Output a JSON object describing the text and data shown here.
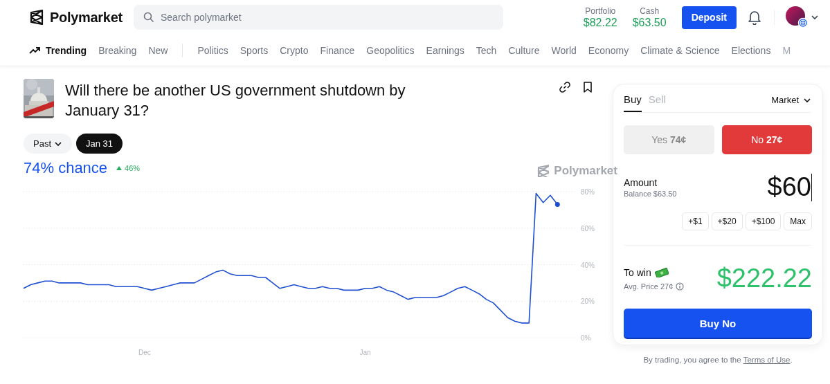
{
  "header": {
    "brand": "Polymarket",
    "search": {
      "placeholder": "Search polymarket"
    },
    "stats": [
      {
        "label": "Portfolio",
        "value": "$82.22"
      },
      {
        "label": "Cash",
        "value": "$63.50"
      }
    ],
    "deposit_button": "Deposit"
  },
  "nav": {
    "items": [
      {
        "label": "Trending",
        "kind": "feed",
        "selected": true,
        "faded": false
      },
      {
        "label": "Breaking",
        "kind": "feed",
        "selected": false,
        "faded": false
      },
      {
        "label": "New",
        "kind": "feed",
        "selected": false,
        "faded": false
      },
      {
        "label": "Politics",
        "kind": "category",
        "selected": false,
        "faded": false
      },
      {
        "label": "Sports",
        "kind": "category",
        "selected": false,
        "faded": false
      },
      {
        "label": "Crypto",
        "kind": "category",
        "selected": false,
        "faded": false
      },
      {
        "label": "Finance",
        "kind": "category",
        "selected": false,
        "faded": false
      },
      {
        "label": "Geopolitics",
        "kind": "category",
        "selected": false,
        "faded": false
      },
      {
        "label": "Earnings",
        "kind": "category",
        "selected": false,
        "faded": false
      },
      {
        "label": "Tech",
        "kind": "category",
        "selected": false,
        "faded": false
      },
      {
        "label": "Culture",
        "kind": "category",
        "selected": false,
        "faded": false
      },
      {
        "label": "World",
        "kind": "category",
        "selected": false,
        "faded": false
      },
      {
        "label": "Economy",
        "kind": "category",
        "selected": false,
        "faded": false
      },
      {
        "label": "Climate & Science",
        "kind": "category",
        "selected": false,
        "faded": false
      },
      {
        "label": "Elections",
        "kind": "category",
        "selected": false,
        "faded": false
      },
      {
        "label": "M",
        "kind": "category",
        "selected": false,
        "faded": true
      }
    ]
  },
  "market": {
    "title": "Will there be another US government shutdown by January 31?",
    "filters": [
      {
        "label": "Past",
        "kind": "dropdown",
        "selected": false
      },
      {
        "label": "Jan 31",
        "kind": "pill",
        "selected": true
      }
    ],
    "chance": "74% chance",
    "change": "46%",
    "watermark": "Polymarket",
    "chart_data": {
      "type": "line",
      "categories": [
        null,
        null,
        null,
        null,
        null,
        null,
        null,
        null,
        null,
        null,
        null,
        null,
        null,
        null,
        null,
        null,
        null,
        "Dec",
        null,
        null,
        null,
        null,
        null,
        null,
        null,
        null,
        null,
        null,
        null,
        null,
        null,
        null,
        null,
        null,
        null,
        null,
        null,
        null,
        null,
        null,
        null,
        null,
        null,
        null,
        null,
        null,
        null,
        null,
        "Jan",
        null,
        null,
        null,
        null,
        null,
        null,
        null,
        null,
        null,
        null,
        null,
        null,
        null,
        null,
        null,
        null,
        null,
        null,
        null,
        null,
        null,
        null,
        null,
        null,
        null,
        null,
        null
      ],
      "series": [
        {
          "color": "#1f4fd1",
          "values": [
            27,
            29,
            30,
            31,
            31,
            30,
            30,
            30,
            30,
            29,
            29,
            29,
            29,
            28,
            28,
            28,
            28,
            27,
            26,
            27,
            28,
            29,
            30,
            30,
            30,
            32,
            34,
            36,
            37,
            35,
            34,
            34,
            34,
            33,
            33,
            30,
            27,
            28,
            29,
            28,
            27,
            27,
            28,
            27,
            27,
            26,
            26,
            26,
            27,
            27,
            28,
            26,
            25,
            23,
            21,
            22,
            22,
            22,
            22,
            23,
            25,
            27,
            28,
            26,
            24,
            21,
            19,
            15,
            11,
            9,
            8,
            8,
            79,
            74,
            78,
            73
          ]
        }
      ],
      "ylim": [
        0,
        80
      ],
      "grid": true,
      "yticks": [
        {
          "value": 0,
          "label": "0%"
        },
        {
          "value": 20,
          "label": "20%"
        },
        {
          "value": 40,
          "label": "40%"
        },
        {
          "value": 60,
          "label": "60%"
        },
        {
          "value": 80,
          "label": "80%"
        }
      ]
    }
  },
  "trade": {
    "tabs": [
      {
        "label": "Buy",
        "selected": true
      },
      {
        "label": "Sell",
        "selected": false
      }
    ],
    "order_type": "Market",
    "outcomes": [
      {
        "label": "Yes",
        "price": "74¢",
        "kind": "yes",
        "selected": false
      },
      {
        "label": "No",
        "price": "27¢",
        "kind": "no",
        "selected": true
      }
    ],
    "amount": {
      "label": "Amount",
      "balance": "Balance $63.50",
      "value": "$60"
    },
    "quick_add": [
      "+$1",
      "+$20",
      "+$100",
      "Max"
    ],
    "to_win": {
      "label": "To win",
      "avg_price": "Avg. Price 27¢",
      "value": "$222.22"
    },
    "buy_button": "Buy No",
    "terms": {
      "text": "By trading, you agree to the",
      "link": "Terms of Use",
      "suffix": "."
    }
  }
}
